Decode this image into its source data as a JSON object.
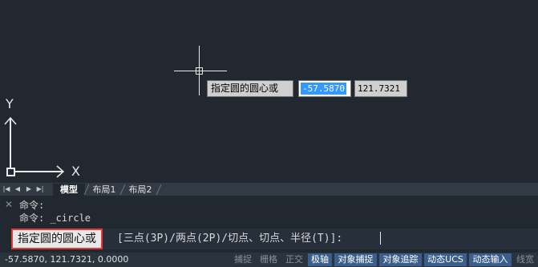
{
  "canvas": {
    "dynamic_input": {
      "prompt": "指定圆的圆心或",
      "x_value": "-57.5870",
      "y_value": "121.7321"
    },
    "ucs": {
      "x_label": "X",
      "y_label": "Y"
    }
  },
  "layout_tabs": {
    "nav_buttons": [
      "first",
      "prev",
      "next",
      "last"
    ],
    "tabs": [
      {
        "label": "模型",
        "active": true
      },
      {
        "label": "布局1",
        "active": false
      },
      {
        "label": "布局2",
        "active": false
      }
    ]
  },
  "command": {
    "history": [
      "命令:",
      "命令: _circle"
    ],
    "prompt_highlight": "指定圆的圆心或",
    "prompt_options": "[三点(3P)/两点(2P)/切点、切点、半径(T)]:"
  },
  "status": {
    "coordinates": "-57.5870, 121.7321, 0.0000",
    "toggles": [
      {
        "label": "捕捉",
        "on": false
      },
      {
        "label": "栅格",
        "on": false
      },
      {
        "label": "正交",
        "on": false
      },
      {
        "label": "极轴",
        "on": true
      },
      {
        "label": "对象捕捉",
        "on": true
      },
      {
        "label": "对象追踪",
        "on": true
      },
      {
        "label": "动态UCS",
        "on": true
      },
      {
        "label": "动态输入",
        "on": true
      },
      {
        "label": "线宽",
        "on": false
      }
    ]
  },
  "colors": {
    "canvas_bg": "#212830",
    "highlight_border": "#e53935",
    "toggle_on_bg": "#3a5f8c"
  }
}
